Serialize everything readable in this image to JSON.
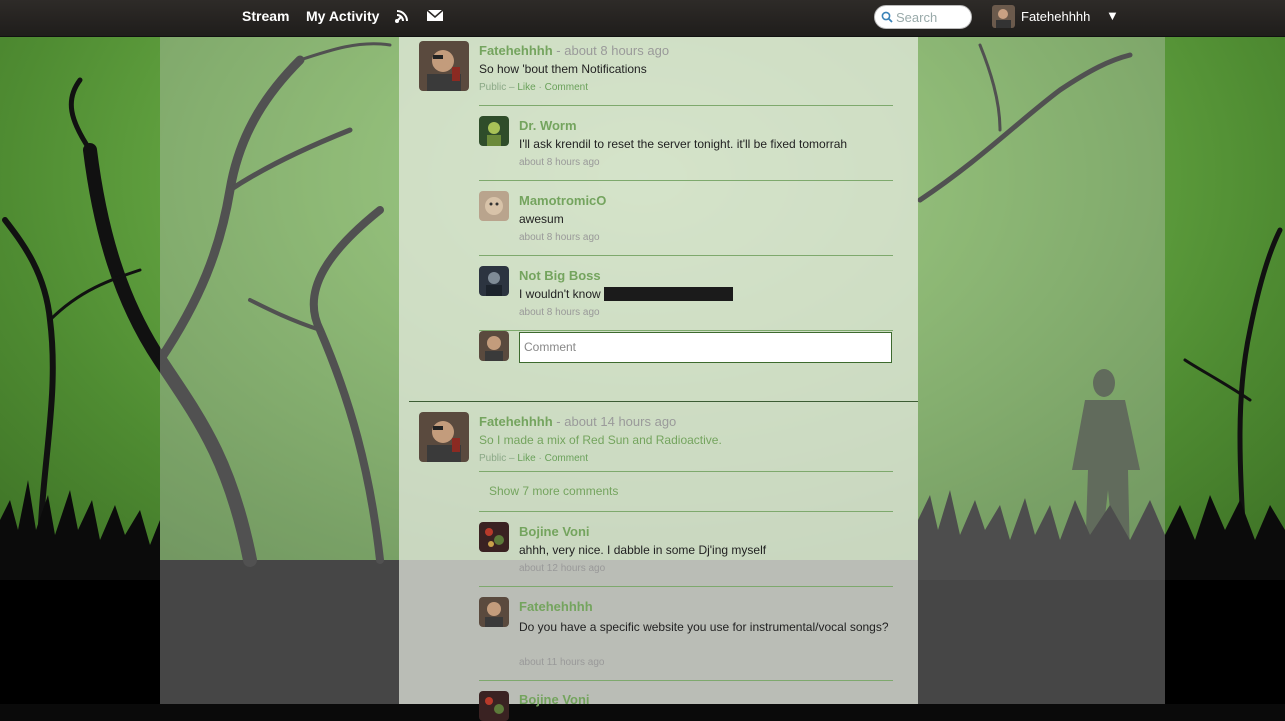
{
  "nav": {
    "stream": "Stream",
    "activity": "My Activity",
    "notifications_icon": "signal-icon",
    "messages_icon": "envelope-icon"
  },
  "search": {
    "placeholder": "Search"
  },
  "user": {
    "name": "Fatehehhhh"
  },
  "posts": [
    {
      "author": "Fatehehhhh",
      "time": "- about 8 hours ago",
      "text": "So how 'bout them Notifications",
      "visibility": "Public",
      "like": "Like",
      "comment": "Comment",
      "comments": [
        {
          "author": "Dr. Worm",
          "text": "I'll ask krendil to reset the server tonight. it'll be fixed tomorrah",
          "time": "about 8 hours ago"
        },
        {
          "author": "MamotromicO",
          "text": "awesum",
          "time": "about 8 hours ago"
        },
        {
          "author": "Not Big Boss",
          "text": "I wouldn't know",
          "time": "about 8 hours ago"
        }
      ],
      "comment_placeholder": "Comment"
    },
    {
      "author": "Fatehehhhh",
      "time": "- about 14 hours ago",
      "text": "So I made a mix of Red Sun and Radioactive.",
      "visibility": "Public",
      "like": "Like",
      "comment": "Comment",
      "show_more": "Show 7 more comments",
      "comments": [
        {
          "author": "Bojine Voni",
          "text": "ahhh, very nice. I dabble in some Dj'ing myself",
          "time": "about 12 hours ago"
        },
        {
          "author": "Fatehehhhh",
          "text": "Do you have a specific website you use for instrumental/vocal songs?",
          "time": "about 11 hours ago"
        },
        {
          "author": "Bojine Voni"
        }
      ]
    }
  ],
  "colors": {
    "accent_green": "#74a45e",
    "topbar": "#2a2725"
  }
}
